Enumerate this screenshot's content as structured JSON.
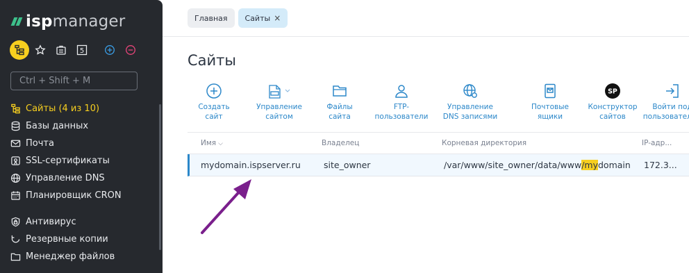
{
  "logo": {
    "part1": "isp",
    "part2": "manager"
  },
  "search": {
    "placeholder": "Ctrl + Shift + M"
  },
  "quick_icons": [
    "sitemap-icon",
    "star-icon",
    "id-card-icon",
    "number-5-icon",
    "plus-circle-icon",
    "minus-circle-icon"
  ],
  "quick_badge": "5",
  "sidebar": {
    "items": [
      {
        "label": "Сайты (4 из 10)",
        "icon": "sites-icon",
        "active": true
      },
      {
        "label": "Базы данных",
        "icon": "database-icon"
      },
      {
        "label": "Почта",
        "icon": "mail-icon"
      },
      {
        "label": "SSL-сертификаты",
        "icon": "ssl-icon"
      },
      {
        "label": "Управление DNS",
        "icon": "globe-icon"
      },
      {
        "label": "Планировщик CRON",
        "icon": "calendar-icon"
      },
      {
        "label": "Антивирус",
        "icon": "shield-lock-icon"
      },
      {
        "label": "Резервные копии",
        "icon": "backup-icon"
      },
      {
        "label": "Менеджер файлов",
        "icon": "folder-icon"
      }
    ]
  },
  "tabs": [
    {
      "label": "Главная"
    },
    {
      "label": "Сайты",
      "close": "×"
    }
  ],
  "page": {
    "title": "Сайты"
  },
  "toolbar": [
    {
      "label": "Создать\nсайт",
      "icon": "plus-circle-icon"
    },
    {
      "label": "Управление\nсайтом",
      "icon": "site-manage-icon"
    },
    {
      "label": "Файлы\nсайта",
      "icon": "folder-icon"
    },
    {
      "label": "FTP-\nпользователи",
      "icon": "ftp-user-icon"
    },
    {
      "label": "Управление\nDNS записями",
      "icon": "dns-settings-icon"
    },
    {
      "label": "Почтовые\nящики",
      "icon": "mailbox-icon"
    },
    {
      "label": "Конструктор\nсайтов",
      "icon": "sp-badge-icon",
      "badge": "SP"
    },
    {
      "label": "Войти под\nпользователем",
      "icon": "login-icon"
    }
  ],
  "table": {
    "columns": [
      "Имя",
      "Владелец",
      "Корневая директория",
      "IP-адр..."
    ],
    "rows": [
      {
        "name": "mydomain.ispserver.ru",
        "owner": "site_owner",
        "root_prefix": "/var/www/site_owner/data/www",
        "root_highlight": "/my",
        "root_suffix": "domain....",
        "ip": "172.3..."
      }
    ]
  },
  "colors": {
    "accent": "#2b87c9",
    "active_yellow": "#f7cf1f",
    "sidebar_bg": "#26292e",
    "annotation_arrow": "#7a1f8c"
  }
}
